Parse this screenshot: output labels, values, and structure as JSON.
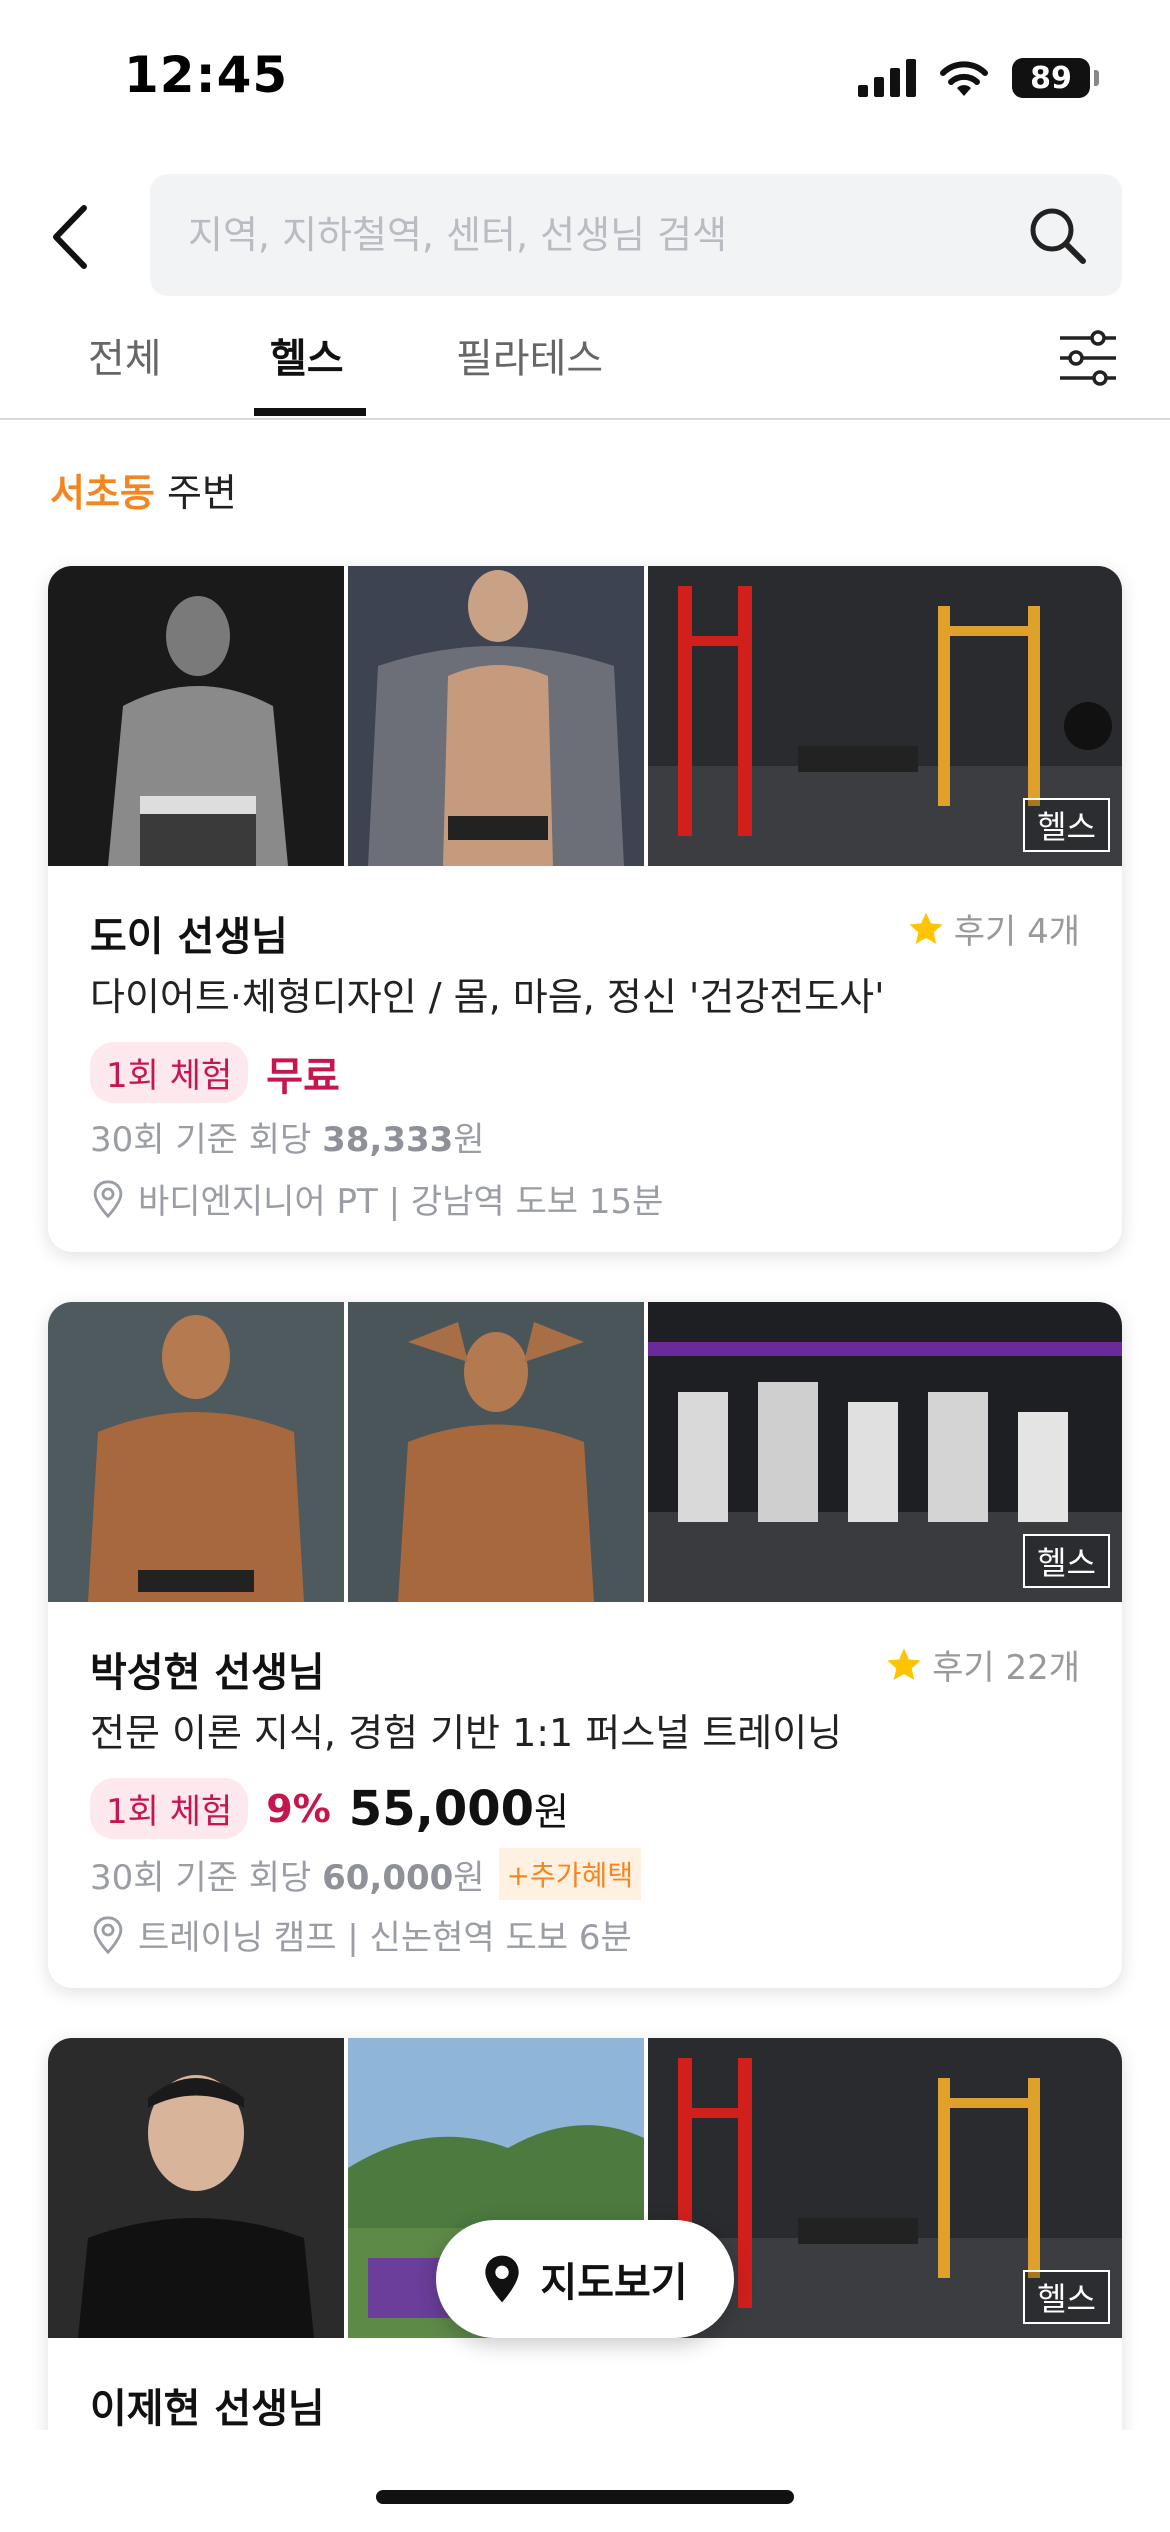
{
  "status_bar": {
    "time": "12:45",
    "battery": "89"
  },
  "search": {
    "placeholder": "지역, 지하철역, 센터, 선생님 검색",
    "value": ""
  },
  "tabs": [
    {
      "label": "전체"
    },
    {
      "label": "헬스",
      "active": true
    },
    {
      "label": "필라테스"
    }
  ],
  "location": {
    "area": "서초동",
    "suffix": " 주변"
  },
  "cards": [
    {
      "category": "헬스",
      "name": "도이 선생님",
      "review": "후기 4개",
      "headline": "다이어트·체형디자인 / 몸, 마음, 정신 '건강전도사'",
      "trial_label": "1회 체험",
      "trial_price": "무료",
      "per_session_prefix": "30회 기준 회당 ",
      "per_session_price": "38,333",
      "per_session_unit": "원",
      "place": "바디엔지니어 PT | 강남역 도보 15분"
    },
    {
      "category": "헬스",
      "name": "박성현 선생님",
      "review": "후기 22개",
      "headline": "전문 이론 지식, 경험 기반 1:1 퍼스널 트레이닝",
      "trial_label": "1회 체험",
      "discount": "9%",
      "price": "55,000",
      "price_unit": "원",
      "per_session_prefix": "30회 기준 회당 ",
      "per_session_price": "60,000",
      "per_session_unit": "원",
      "extra_benefit": "+추가혜택",
      "place": "트레이닝 캠프 | 신논현역 도보 6분"
    },
    {
      "category": "헬스",
      "name": "이제현 선생님"
    }
  ],
  "map_button": {
    "label": "지도보기"
  },
  "colors": {
    "accent_orange": "#f5861f",
    "accent_red": "#c7164c",
    "star": "#ffc400"
  }
}
